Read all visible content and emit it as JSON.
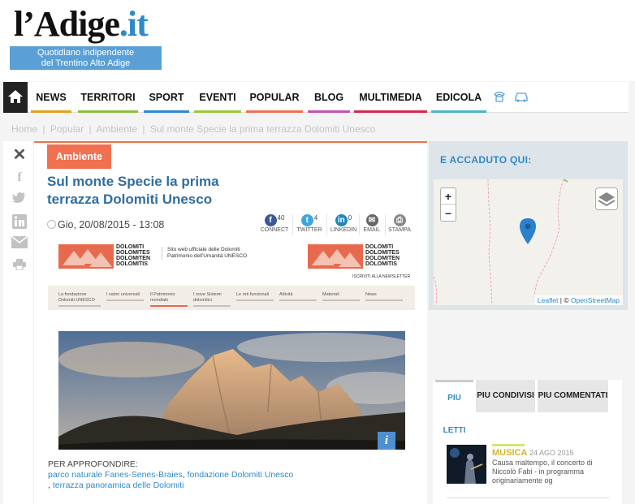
{
  "header": {
    "logo_main": "l’Adige",
    "logo_tld": ".it",
    "tagline_line1": "Quotidiano indipendente",
    "tagline_line2": "del Trentino Alto Adige"
  },
  "nav": {
    "items": [
      {
        "label": "NEWS",
        "color": "#e5a31a"
      },
      {
        "label": "TERRITORI",
        "color": "#8bbf3a"
      },
      {
        "label": "SPORT",
        "color": "#2e8bd0"
      },
      {
        "label": "EVENTI",
        "color": "#9ac93a"
      },
      {
        "label": "POPULAR",
        "color": "#f07050"
      },
      {
        "label": "BLOG",
        "color": "#c552b8"
      },
      {
        "label": "MULTIMEDIA",
        "color": "#d4294c"
      },
      {
        "label": "EDICOLA",
        "color": "#4fb4c8"
      }
    ]
  },
  "breadcrumb": [
    "Home",
    "|",
    "Popular",
    "|",
    "Ambiente",
    "|",
    "Sul monte Specie la prima terrazza Dolomiti Unesco"
  ],
  "article": {
    "category": "Ambiente",
    "title": "Sul monte Specie la prima terrazza Dolomiti Unesco",
    "date": "Gio, 20/08/2015 - 13:08",
    "share": {
      "facebook": {
        "count": "40",
        "label": "CONNECT"
      },
      "twitter": {
        "count": "4",
        "label": "TWITTER"
      },
      "linkedin": {
        "count": "0",
        "label": "LINKEDIN"
      },
      "email": {
        "label": "EMAIL"
      },
      "print": {
        "label": "STAMPA"
      }
    },
    "embed": {
      "brand": "DOLOMITI DOLOMITES DOLOMITEN DOLOMITIS",
      "site_line1": "Sito web ufficiale delle Dolomiti",
      "site_line2": "Patrimonio dell'Umanità UNESCO",
      "newsletter": "ISCRIVITI ALLA NEWSLETTER",
      "menu": [
        "La fondazione Dolomiti UNESCO",
        "I valori universali",
        "Il Patrimonio mondiale",
        "I nove Sistemi dolomitici",
        "Le reti funzionali",
        "Attività",
        "Materiali",
        "News"
      ]
    },
    "further_label": "PER APPROFONDIRE:",
    "further_links": [
      "parco naturale Fanes-Senes-Braies",
      "fondazione Dolomiti Unesco",
      "terrazza panoramica delle Dolomiti"
    ]
  },
  "sidebar": {
    "happened_title": "E ACCADUTO QUI:",
    "map_attribution_leaflet": "Leaflet",
    "map_attribution_osm": "OpenStreetMap",
    "tabs": [
      "PIU LETTI",
      "PIU CONDIVISI",
      "PIU COMMENTATI"
    ],
    "news": {
      "category": "MUSICA",
      "date": "24 AGO 2015",
      "text": "Causa maltempo, il concerto di Niccolò Fabi - in programma originariamente og"
    }
  }
}
